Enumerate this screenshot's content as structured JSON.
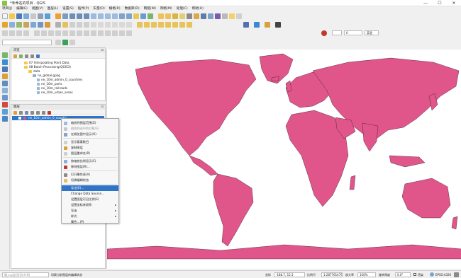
{
  "window": {
    "title": "*未命名的项目 - QGIS",
    "min": "—",
    "max": "☐",
    "close": "✕"
  },
  "menubar": [
    "项目(J)",
    "编辑(E)",
    "视图(V)",
    "图层(L)",
    "设置(S)",
    "插件(P)",
    "矢量(O)",
    "栅格(R)",
    "数据库(D)",
    "网络(W)",
    "网格(M)",
    "处理(C)",
    "帮助(H)"
  ],
  "toolbar": {
    "scale_field": "0",
    "units_label": "英里"
  },
  "browser_panel": {
    "title": "浏览",
    "items": [
      {
        "label": "07 Interpolating Point Data",
        "type": "folder"
      },
      {
        "label": "08 Batch-Processing(QGIS3)",
        "type": "folder"
      },
      {
        "label": "data",
        "type": "folder"
      },
      {
        "label": "ne_global.gpkg",
        "type": "folder"
      },
      {
        "label": "ne_10m_admin_0_countries",
        "type": "layer"
      },
      {
        "label": "ne_10m_ports",
        "type": "layer"
      },
      {
        "label": "ne_10m_railroads",
        "type": "layer"
      },
      {
        "label": "ne_10m_urban_areas",
        "type": "layer"
      }
    ]
  },
  "layers_panel": {
    "title": "图层",
    "layer": "ne_10m_admin_0_countri"
  },
  "context_menu": [
    {
      "label": "缩放到图层范围(Z)",
      "state": "normal"
    },
    {
      "label": "缩放到选中的对象(S)",
      "state": "disabled"
    },
    {
      "label": "在概览图中显示(O)",
      "state": "normal"
    },
    {
      "label": "显示要素数目",
      "state": "normal"
    },
    {
      "label": "复制图层",
      "state": "normal"
    },
    {
      "label": "图层重命名(R)",
      "state": "normal"
    },
    {
      "label": "按缩放比例显示(C)",
      "state": "normal"
    },
    {
      "label": "移除图层(R)…",
      "state": "normal"
    },
    {
      "label": "打开属性表(A)",
      "state": "normal"
    },
    {
      "label": "切换编辑状态",
      "state": "normal"
    },
    {
      "label": "导出(E)…",
      "state": "highlight"
    },
    {
      "label": "Change Data Source…",
      "state": "normal"
    },
    {
      "label": "设置图层可见比例(S)",
      "state": "normal"
    },
    {
      "label": "设置坐标参照系",
      "state": "submenu"
    },
    {
      "label": "导出",
      "state": "submenu"
    },
    {
      "label": "样式",
      "state": "submenu"
    },
    {
      "label": "属性…(P)",
      "state": "normal"
    }
  ],
  "statusbar": {
    "locator_placeholder": "键入以定位(Ctrl+K)",
    "message": "切换当前图层的编辑状态",
    "coord_label": "坐标",
    "coordinate": "-188.7,-15.5",
    "scale_label": "比例尺",
    "scale": "1:287761479",
    "magnifier_label": "放大率",
    "magnifier": "100%",
    "rotation_label": "旋转角度",
    "rotation": "0.0°",
    "render_label": "渲染",
    "crs": "EPSG:4326"
  },
  "colors": {
    "land": "#e0568a",
    "highlight": "#3074c8"
  }
}
